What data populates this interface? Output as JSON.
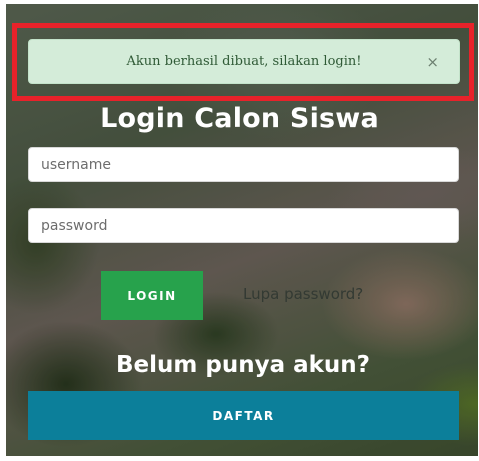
{
  "alert": {
    "message": "Akun berhasil dibuat, silakan login!",
    "close_symbol": "×",
    "bg_color": "#d4ecd9",
    "highlight_color": "#e8222a"
  },
  "login": {
    "title": "Login Calon Siswa",
    "username_placeholder": "username",
    "password_placeholder": "password",
    "login_label": "LOGIN",
    "forgot_label": "Lupa password?"
  },
  "register": {
    "prompt": "Belum punya akun?",
    "button_label": "DAFTAR"
  },
  "colors": {
    "login_button": "#27a24c",
    "register_button": "#0c7f9a"
  }
}
